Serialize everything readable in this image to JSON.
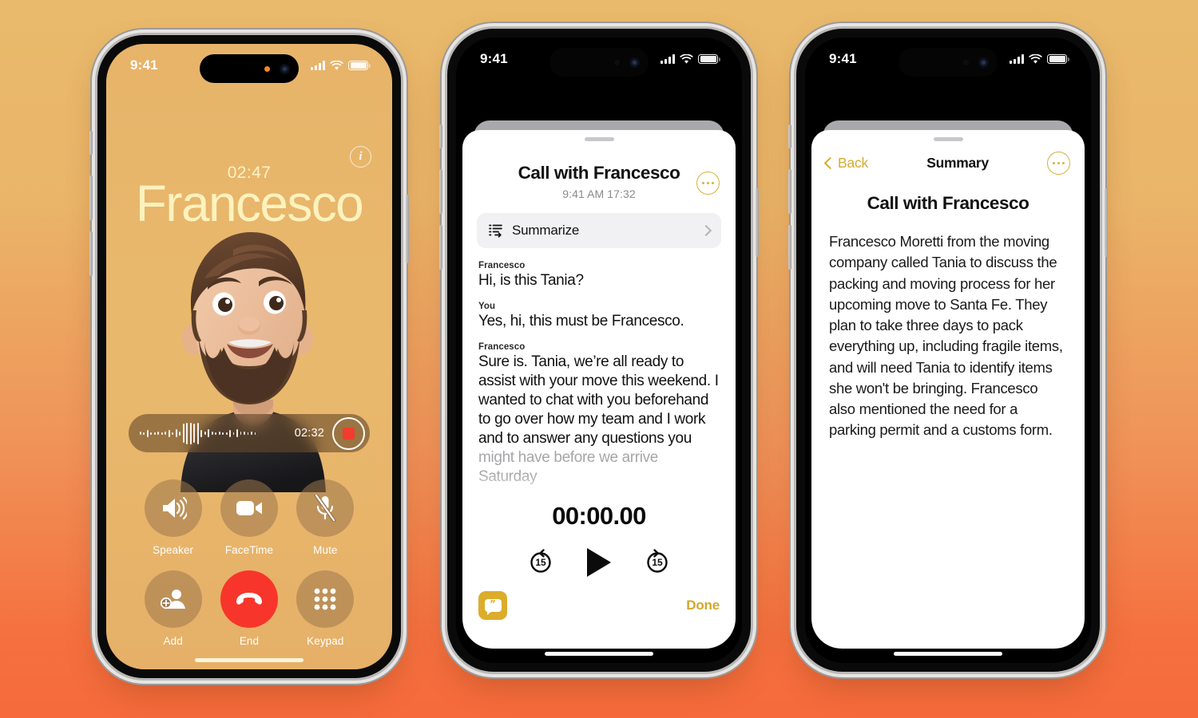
{
  "phone1": {
    "status_bar": {
      "time": "9:41",
      "cellular_icon": "cellular-bars-icon",
      "wifi_icon": "wifi-icon",
      "battery_icon": "battery-icon"
    },
    "dynamic_island": {
      "recording_indicator": "orange-recording-dot",
      "camera_icon": "front-camera-lens"
    },
    "info_button_label": "i",
    "call_timer": "02:47",
    "caller_name": "Francesco",
    "avatar": "memoji-avatar",
    "recording_pill": {
      "elapsed": "02:32",
      "stop_icon": "stop-record-icon",
      "waveform": "audio-waveform"
    },
    "controls": [
      {
        "label": "Speaker",
        "icon": "speaker-icon"
      },
      {
        "label": "FaceTime",
        "icon": "video-camera-icon"
      },
      {
        "label": "Mute",
        "icon": "microphone-muted-icon"
      },
      {
        "label": "Add",
        "icon": "add-person-icon"
      },
      {
        "label": "End",
        "icon": "end-call-icon"
      },
      {
        "label": "Keypad",
        "icon": "keypad-icon"
      }
    ]
  },
  "phone2": {
    "status_bar": {
      "time": "9:41"
    },
    "title": "Call with Francesco",
    "subtitle": "9:41 AM  17:32",
    "more_button": "more-options-icon",
    "summarize": {
      "label": "Summarize",
      "icon": "summarize-icon",
      "chevron": "chevron-right-icon"
    },
    "transcript": [
      {
        "speaker": "Francesco",
        "text": "Hi, is this Tania?",
        "faded": false
      },
      {
        "speaker": "You",
        "text": "Yes, hi, this must be Francesco.",
        "faded": false
      },
      {
        "speaker": "Francesco",
        "text": "Sure is. Tania, we’re all ready to assist with your move this weekend. I wanted to chat with you beforehand to go over how my team and I work and to answer any questions you",
        "faded": false
      },
      {
        "speaker": "",
        "text": "might have before we arrive Saturday",
        "faded": true
      }
    ],
    "player": {
      "time": "00:00.00",
      "rewind_label": "15",
      "forward_label": "15",
      "play_icon": "play-icon",
      "rewind_icon": "rewind-15-icon",
      "forward_icon": "forward-15-icon"
    },
    "live_transcript_icon": "live-transcription-icon",
    "live_transcript_glyph": "”",
    "done_label": "Done"
  },
  "phone3": {
    "status_bar": {
      "time": "9:41"
    },
    "back_label": "Back",
    "nav_title": "Summary",
    "more_button": "more-options-icon",
    "heading": "Call with Francesco",
    "body": "Francesco Moretti from the moving company called Tania to discuss the packing and moving process for her upcoming move to Santa Fe. They plan to take three days to pack everything up, including fragile items, and will need Tania to identify items she won't be bringing. Francesco also mentioned the need for a parking permit and a customs form."
  },
  "colors": {
    "background_top": "#e9ba6b",
    "background_bottom": "#f5713f",
    "call_screen": "#e7b46a",
    "accent_gold": "#d6ab2e",
    "end_call_red": "#f8352b",
    "record_red": "#f23c2e",
    "caller_name_text": "#fdf2bd"
  }
}
